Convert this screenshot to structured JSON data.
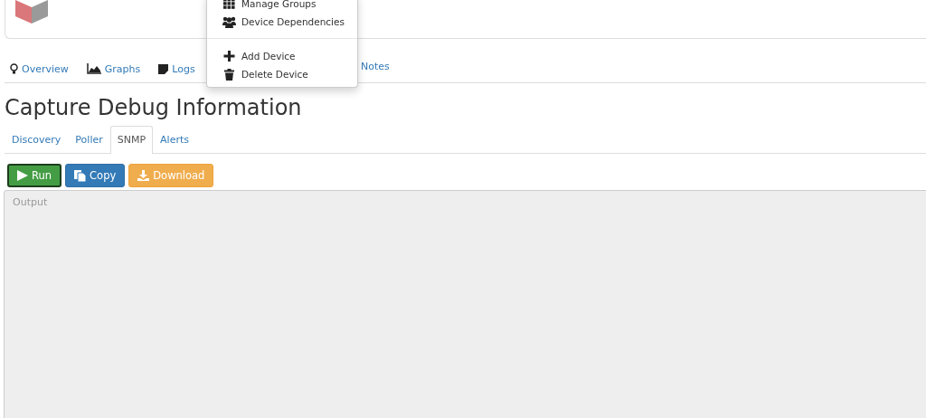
{
  "device_tabs": [
    {
      "kind": "overview",
      "label": "Overview",
      "selected": false
    },
    {
      "kind": "graphs",
      "label": "Graphs",
      "selected": false
    },
    {
      "kind": "logs",
      "label": "Logs",
      "selected": false
    },
    {
      "kind": "notes",
      "label": "Notes",
      "selected": false
    }
  ],
  "device_menu": [
    {
      "kind": "groups",
      "label": "Manage Groups"
    },
    {
      "kind": "dependencies",
      "label": "Device Dependencies"
    },
    {
      "kind": "divider"
    },
    {
      "kind": "add",
      "label": "Add Device"
    },
    {
      "kind": "delete",
      "label": "Delete Device"
    }
  ],
  "heading": "Capture Debug Information",
  "debug_tabs": [
    {
      "label": "Discovery",
      "selected": false
    },
    {
      "label": "Poller",
      "selected": false
    },
    {
      "label": "SNMP",
      "selected": true
    },
    {
      "label": "Alerts",
      "selected": false
    }
  ],
  "actions": [
    {
      "kind": "run",
      "label": "Run"
    },
    {
      "kind": "copy",
      "label": "Copy"
    },
    {
      "kind": "download",
      "label": "Download"
    }
  ],
  "output": {
    "placeholder": "Output"
  }
}
